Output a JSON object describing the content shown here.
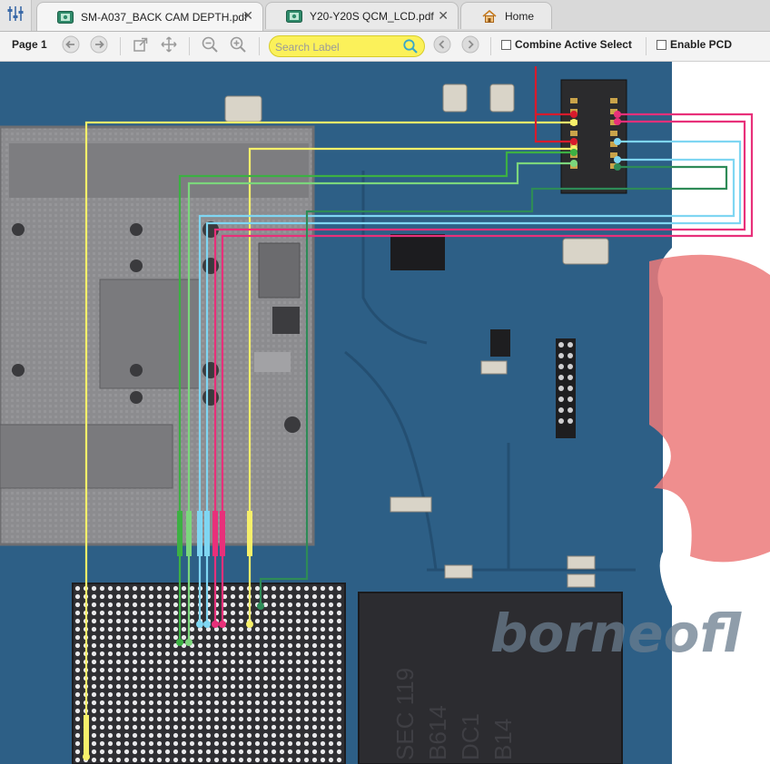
{
  "tabs": [
    {
      "label": "SM-A037_BACK CAM DEPTH.pdf",
      "active": true,
      "closable": true,
      "icon": "pcb-file-icon"
    },
    {
      "label": "Y20-Y20S QCM_LCD.pdf",
      "active": false,
      "closable": true,
      "icon": "pcb-file-icon"
    },
    {
      "label": "Home",
      "active": false,
      "closable": false,
      "icon": "home-icon"
    }
  ],
  "toolbar": {
    "page_label": "Page 1",
    "search_placeholder": "Search Label",
    "combine_label": "Combine Active Select",
    "combine_checked": false,
    "enable_pcd_label": "Enable PCD",
    "enable_pcd_checked": false
  },
  "icons": {
    "menu": "sliders-icon",
    "back": "arrow-left-icon",
    "forward": "arrow-right-icon",
    "share": "share-icon",
    "move": "move-icon",
    "zoom_out": "zoom-out-icon",
    "zoom_in": "zoom-in-icon",
    "search": "search-icon",
    "prev": "chevron-left-icon",
    "next": "chevron-right-icon"
  },
  "colors": {
    "accent_yellow": "#fbf15a",
    "net_yellow": "#f7f06a",
    "net_pink": "#e8307a",
    "net_cyan": "#7fd6f2",
    "net_green": "#3cb043",
    "net_red": "#d81b2c",
    "board_blue": "#2d5f86"
  },
  "board": {
    "chip_marking_lines": [
      "SEC 119",
      "B614",
      "DC1",
      "B14"
    ],
    "watermark": "borneofl"
  }
}
